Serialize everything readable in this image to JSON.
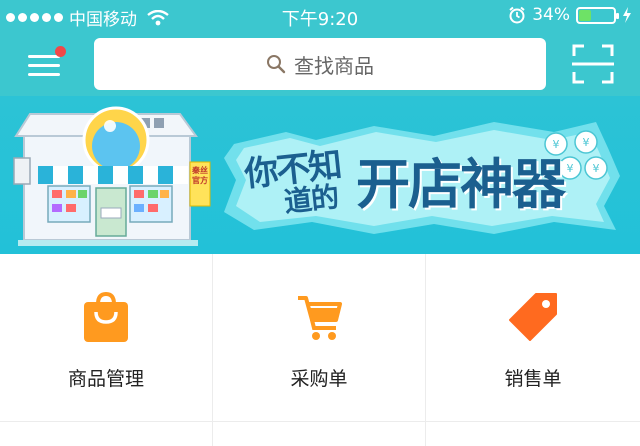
{
  "status_bar": {
    "carrier": "中国移动",
    "time": "下午9:20",
    "battery_percent": "34%",
    "battery_level": 0.34
  },
  "header": {
    "search_placeholder": "查找商品",
    "icons": [
      "menu-icon",
      "search-icon",
      "scan-icon"
    ],
    "notification_dot_color": "#f04848",
    "accent_color": "#3cc7cf"
  },
  "banner": {
    "line1": "你不知",
    "line2": "道的",
    "headline": "开店神器",
    "shop_sign": "秦丝官方"
  },
  "features": [
    {
      "label": "商品管理",
      "icon": "shopping-bag-icon",
      "color": "#ff9a1f"
    },
    {
      "label": "采购单",
      "icon": "shopping-cart-icon",
      "color": "#ff9a1f"
    },
    {
      "label": "销售单",
      "icon": "price-tag-icon",
      "color": "#ff6a1f"
    }
  ]
}
